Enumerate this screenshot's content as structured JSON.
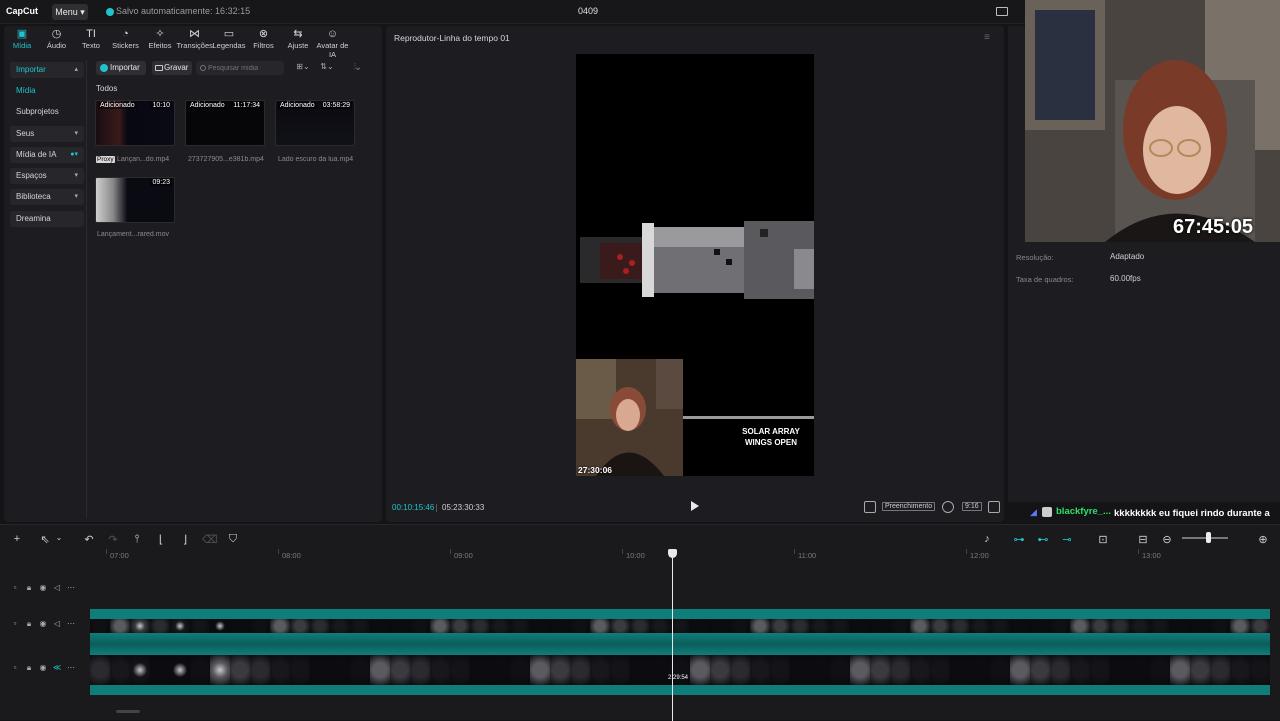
{
  "titlebar": {
    "logo": "CapCut",
    "menu_label": "Menu",
    "autosave": "Salvo automaticamente: 16:32:15",
    "project_title": "0409"
  },
  "media_tabs": [
    {
      "label": "Mídia",
      "icon": "media-icon",
      "glyph": "▣",
      "active": true
    },
    {
      "label": "Áudio",
      "icon": "audio-icon",
      "glyph": "◷",
      "active": false
    },
    {
      "label": "Texto",
      "icon": "text-icon",
      "glyph": "TI",
      "active": false
    },
    {
      "label": "Stickers",
      "icon": "stickers-icon",
      "glyph": "◔",
      "active": false
    },
    {
      "label": "Efeitos",
      "icon": "effects-icon",
      "glyph": "✧",
      "active": false
    },
    {
      "label": "Transições",
      "icon": "transitions-icon",
      "glyph": "⋈",
      "active": false
    },
    {
      "label": "Legendas",
      "icon": "captions-icon",
      "glyph": "▭",
      "active": false
    },
    {
      "label": "Filtros",
      "icon": "filters-icon",
      "glyph": "⊗",
      "active": false
    },
    {
      "label": "Ajuste",
      "icon": "adjust-icon",
      "glyph": "⇆",
      "active": false
    },
    {
      "label": "Avatar de IA",
      "icon": "ai-avatar-icon",
      "glyph": "☺",
      "active": false
    }
  ],
  "left_nav": {
    "importar": "Importar",
    "midia": "Mídia",
    "subprojetos": "Subprojetos",
    "seus": "Seus",
    "midia_ia": "Mídia de IA",
    "espacos": "Espaços",
    "biblioteca": "Biblioteca",
    "dreamina": "Dreamina"
  },
  "media_toolbar": {
    "import_label": "Importar",
    "record_label": "Gravar",
    "search_placeholder": "Pesquisar mídia"
  },
  "media": {
    "section_label": "Todos",
    "proxy_badge": "Proxy",
    "items": [
      {
        "added": "Adicionado",
        "duration": "10:10",
        "name": "Lançan...do.mp4"
      },
      {
        "added": "Adicionado",
        "duration": "11:17:34",
        "name": "273727905...e381b.mp4"
      },
      {
        "added": "Adicionado",
        "duration": "03:58:29",
        "name": "Lado escuro da lua.mp4"
      },
      {
        "added": "",
        "duration": "09:23",
        "name": "Lançament...rared.mov"
      }
    ]
  },
  "player": {
    "title": "Reprodutor-Linha do tempo 01",
    "cam_time": "27:30:06",
    "overlay_text_1": "SOLAR ARRAY",
    "overlay_text_2": "WINGS OPEN",
    "time_current": "00:10:15:46",
    "time_total": "05:23:30:33",
    "fill_label": "Preenchimento",
    "ratio_label": "9:16"
  },
  "details": {
    "resolution_label": "Resolução:",
    "resolution_value": "Adaptado",
    "framerate_label": "Taxa de quadros:",
    "framerate_value": "60.00fps"
  },
  "webcam": {
    "timer": "67:45:05"
  },
  "chat": {
    "user": "blackfyre_...",
    "message": "kkkkkkkk eu fiquei rindo durante a conversa kkkkk mas foi legal"
  },
  "timeline": {
    "ruler_labels": [
      "07:00",
      "08:00",
      "09:00",
      "10:00",
      "11:00",
      "12:00",
      "13:00"
    ],
    "playhead_label": "2:29:54"
  },
  "colors": {
    "accent": "#20c4cb",
    "clip_teal": "#0f7e7a",
    "chat_user": "#2ee06a"
  }
}
